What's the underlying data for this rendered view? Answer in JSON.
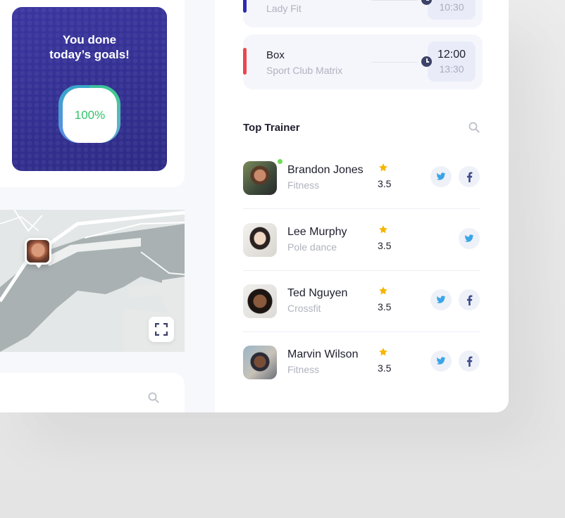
{
  "goals": {
    "title": "You done\ntoday’s goals!",
    "progress_label": "100%",
    "progress_fraction": 1.0
  },
  "classes": [
    {
      "name": "",
      "club": "Lady Fit",
      "start": "",
      "end": "10:30",
      "color": "#2b2bb3"
    },
    {
      "name": "Box",
      "club": "Sport Club Matrix",
      "start": "12:00",
      "end": "13:30",
      "color": "#e8474f"
    }
  ],
  "top_trainer": {
    "title": "Top Trainer",
    "search_icon": "search-icon",
    "trainers": [
      {
        "name": "Brandon Jones",
        "specialty": "Fitness",
        "rating": "3.5",
        "online": true,
        "socials": [
          "twitter",
          "facebook"
        ]
      },
      {
        "name": "Lee Murphy",
        "specialty": "Pole dance",
        "rating": "3.5",
        "online": false,
        "socials": [
          "twitter"
        ]
      },
      {
        "name": "Ted Nguyen",
        "specialty": "Crossfit",
        "rating": "3.5",
        "online": false,
        "socials": [
          "twitter",
          "facebook"
        ]
      },
      {
        "name": "Marvin Wilson",
        "specialty": "Fitness",
        "rating": "3.5",
        "online": false,
        "socials": [
          "twitter",
          "facebook"
        ]
      }
    ]
  },
  "map": {
    "expand_icon": "expand-icon",
    "pin_icon": "user-pin-icon"
  },
  "colors": {
    "accent": "#332f8f",
    "success": "#35c26a",
    "star": "#f7b500",
    "twitter": "#3aa5e8",
    "facebook": "#3d4a8c"
  }
}
